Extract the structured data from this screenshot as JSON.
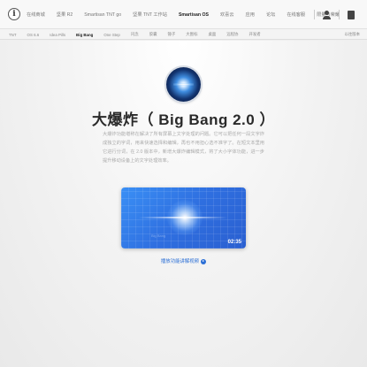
{
  "header": {
    "logo_letter": "i",
    "nav": [
      {
        "label": "在线商城",
        "active": false
      },
      {
        "label": "坚果 R2",
        "active": false
      },
      {
        "label": "Smartisan TNT go",
        "active": false
      },
      {
        "label": "坚果 TNT 工作站",
        "active": false
      },
      {
        "label": "Smartisan OS",
        "active": true
      },
      {
        "label": "欢喜云",
        "active": false
      },
      {
        "label": "应用",
        "active": false
      },
      {
        "label": "论坛",
        "active": false
      },
      {
        "label": "在线客服",
        "active": false
      },
      {
        "label": "限量与荣耀",
        "active": false
      }
    ]
  },
  "subnav": {
    "items": [
      {
        "label": "TNT",
        "active": false
      },
      {
        "label": "OS 6.6",
        "active": false
      },
      {
        "label": "Idea Pills",
        "active": false
      },
      {
        "label": "Big Bang",
        "active": true
      },
      {
        "label": "One Step",
        "active": false
      },
      {
        "label": "闪念",
        "active": false
      },
      {
        "label": "胶囊",
        "active": false
      },
      {
        "label": "锤子",
        "active": false
      },
      {
        "label": "大图标",
        "active": false
      },
      {
        "label": "桌面",
        "active": false
      },
      {
        "label": "远程协",
        "active": false
      },
      {
        "label": "开发者",
        "active": false
      }
    ],
    "right": "以往版本"
  },
  "hero": {
    "title": "大爆炸（ Big Bang 2.0 ）",
    "description": "大爆炸功能堪称在解决了所有屏幕上文字处理的问题。它可以把任何一段文字炸成独立的字词，用来快速选择和编辑，再也不用担心选不准字了。在短文本里用它进行分词，在 2.0 版本中，新增大爆炸编辑模式，将了大小字体功能，进一步提升移动设备上的文字处理效率。"
  },
  "video": {
    "duration": "02:35",
    "link_label": "播放功能讲解视频",
    "overlay_hint": "Big Bang"
  }
}
